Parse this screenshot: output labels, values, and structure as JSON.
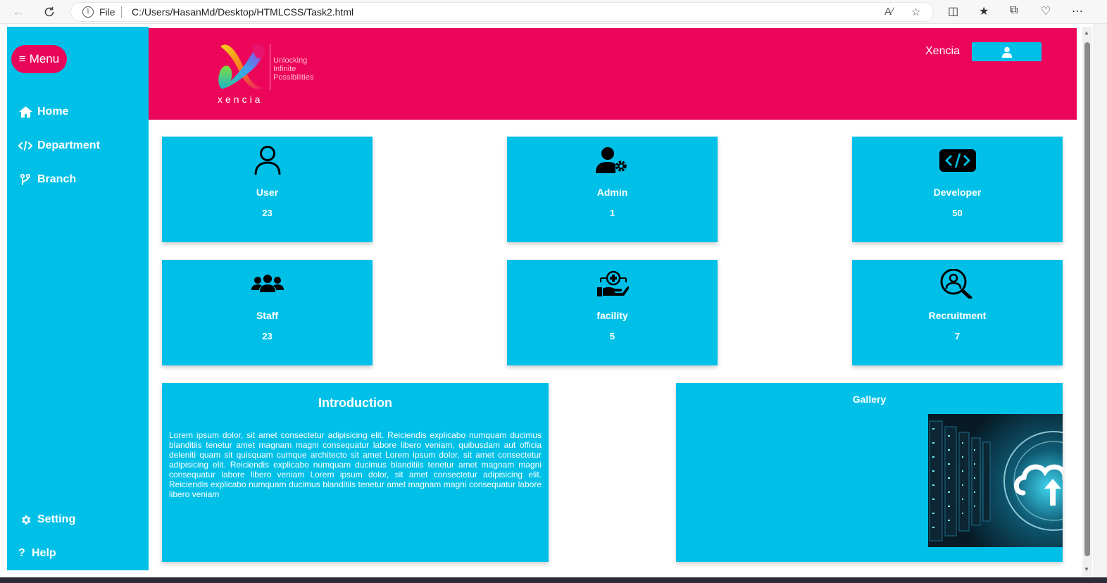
{
  "browser": {
    "file_label": "File",
    "url": "C:/Users/HasanMd/Desktop/HTMLCSS/Task2.html"
  },
  "sidebar": {
    "menu_label": "Menu",
    "items": [
      {
        "label": "Home",
        "icon": "home-icon"
      },
      {
        "label": "Department",
        "icon": "code-icon"
      },
      {
        "label": "Branch",
        "icon": "branch-icon"
      }
    ],
    "bottom_items": [
      {
        "label": "Setting",
        "icon": "gear-icon"
      },
      {
        "label": "Help",
        "icon": "question-icon"
      }
    ]
  },
  "header": {
    "logo_word": "xencia",
    "logo_tagline": [
      "Unlocking",
      "Infinite",
      "Possibilities"
    ],
    "user_name": "Xencia",
    "bg_color": "#ec065a"
  },
  "cards": [
    {
      "title": "User",
      "value": "23",
      "icon": "user-icon"
    },
    {
      "title": "Admin",
      "value": "1",
      "icon": "admin-gear-icon"
    },
    {
      "title": "Developer",
      "value": "50",
      "icon": "code-icon"
    },
    {
      "title": "Staff",
      "value": "23",
      "icon": "users-group-icon"
    },
    {
      "title": "facility",
      "value": "5",
      "icon": "hand-medical-icon"
    },
    {
      "title": "Recruitment",
      "value": "7",
      "icon": "search-user-icon"
    }
  ],
  "intro": {
    "title": "Introduction",
    "text": "Lorem ipsum dolor, sit amet consectetur adipisicing elit. Reiciendis explicabo numquam ducimus blanditiis tenetur amet magnam magni consequatur labore libero veniam, quibusdam aut officia deleniti quam sit quisquam cumque architecto sit amet Lorem ipsum dolor, sit amet consectetur adipisicing elit. Reiciendis explicabo numquam ducimus blanditiis tenetur amet magnam magni consequatur labore libero veniam Lorem ipsum dolor, sit amet consectetur adipisicing elit. Reiciendis explicabo numquam ducimus blanditiis tenetur amet magnam magni consequatur labore libero veniam"
  },
  "gallery": {
    "title": "Gallery",
    "image": "cloud-server-image"
  },
  "colors": {
    "accent_cyan": "#00c0e8",
    "brand_pink": "#ec065a"
  }
}
